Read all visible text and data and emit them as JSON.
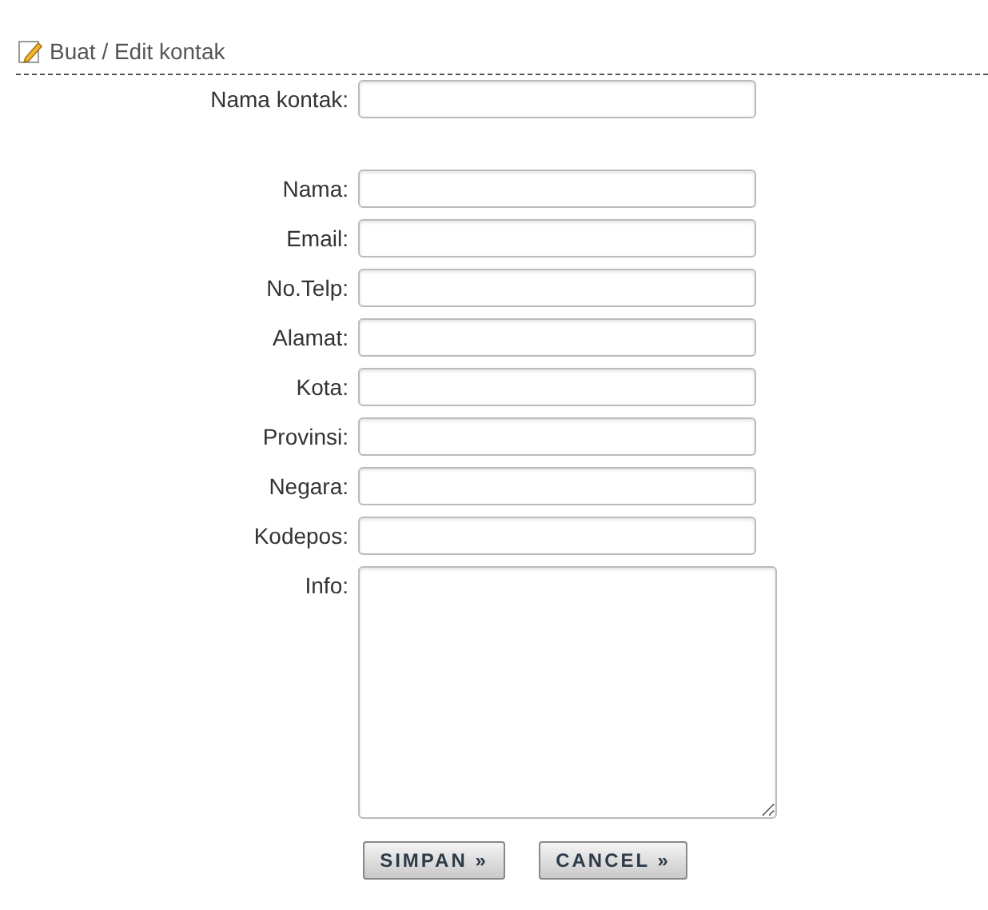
{
  "heading": "Buat / Edit kontak",
  "contact_name": {
    "label": "Nama kontak:"
  },
  "fields": [
    {
      "label": "Nama:",
      "kind": "input"
    },
    {
      "label": "Email:",
      "kind": "input"
    },
    {
      "label": "No.Telp:",
      "kind": "input"
    },
    {
      "label": "Alamat:",
      "kind": "input"
    },
    {
      "label": "Kota:",
      "kind": "input"
    },
    {
      "label": "Provinsi:",
      "kind": "input"
    },
    {
      "label": "Negara:",
      "kind": "input"
    },
    {
      "label": "Kodepos:",
      "kind": "input"
    },
    {
      "label": "Info:",
      "kind": "textarea"
    }
  ],
  "buttons": [
    "SIMPAN »",
    "CANCEL »"
  ]
}
